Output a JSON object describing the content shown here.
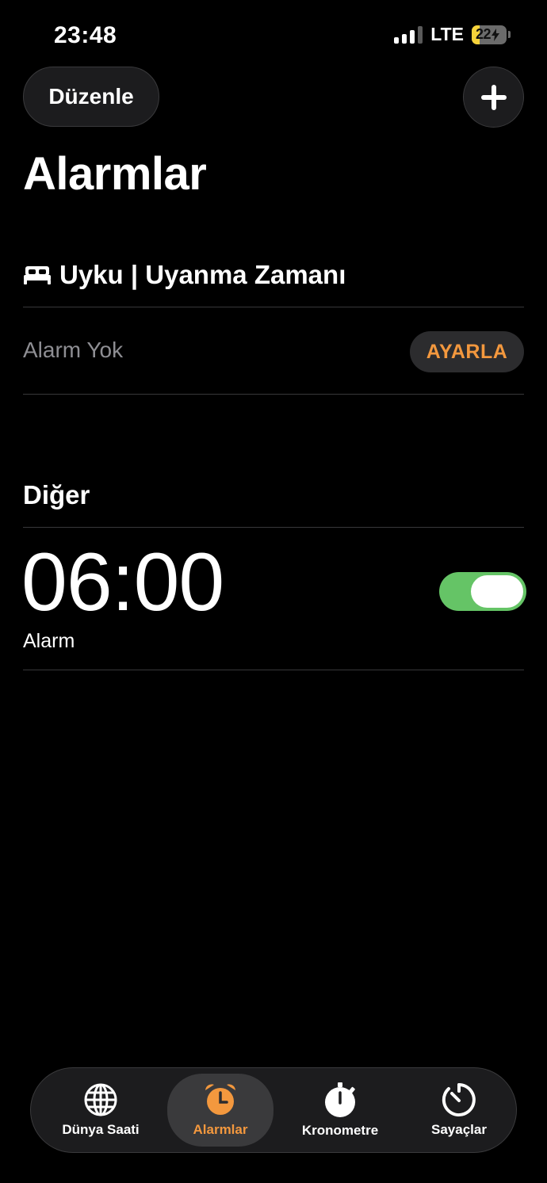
{
  "status": {
    "time": "23:48",
    "network": "LTE",
    "battery": "22",
    "battery_level": 0.22
  },
  "header": {
    "edit_label": "Düzenle",
    "title": "Alarmlar"
  },
  "sleep": {
    "title": "Uyku | Uyanma Zamanı",
    "no_alarm": "Alarm Yok",
    "set_label": "AYARLA"
  },
  "other": {
    "title": "Diğer"
  },
  "alarms": [
    {
      "time": "06:00",
      "label": "Alarm",
      "enabled": true
    }
  ],
  "tabs": [
    {
      "label": "Dünya Saati",
      "icon": "globe-icon"
    },
    {
      "label": "Alarmlar",
      "icon": "alarm-clock-icon",
      "active": true
    },
    {
      "label": "Kronometre",
      "icon": "stopwatch-icon"
    },
    {
      "label": "Sayaçlar",
      "icon": "timer-icon"
    }
  ],
  "colors": {
    "accent": "#f3983e",
    "toggle_on": "#65c466",
    "battery": "#f7d33a"
  }
}
